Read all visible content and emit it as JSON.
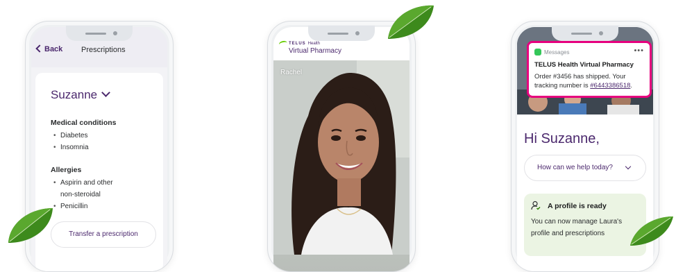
{
  "phone1": {
    "back_label": "Back",
    "title": "Prescriptions",
    "patient_name": "Suzanne",
    "medical_conditions": {
      "heading": "Medical conditions",
      "items": [
        "Diabetes",
        "Insomnia"
      ]
    },
    "allergies": {
      "heading": "Allergies",
      "items": [
        "Aspirin and other",
        "non-steroidal",
        "Penicillin"
      ]
    },
    "transfer_button": "Transfer a prescription"
  },
  "phone2": {
    "brand_top": "TELUS",
    "brand_health": "Health",
    "brand_main": "Virtual Pharmacy",
    "caller_name": "Rachel"
  },
  "phone3": {
    "notification": {
      "app": "Messages",
      "title": "TELUS Health Virtual Pharmacy",
      "body_prefix": "Order #3456 has shipped. Your tracking number is ",
      "tracking_number": "#6443386518",
      "body_suffix": "."
    },
    "greeting": "Hi Suzanne,",
    "help_dropdown": "How can we help today?",
    "profile_card": {
      "title": "A profile is ready",
      "body": "You can now manage Laura's profile and prescriptions"
    }
  },
  "colors": {
    "brand_purple": "#4b286d",
    "notification_border": "#e6007e",
    "card_green_bg": "#ebf4e3",
    "leaf_green": "#3f8a1f"
  }
}
